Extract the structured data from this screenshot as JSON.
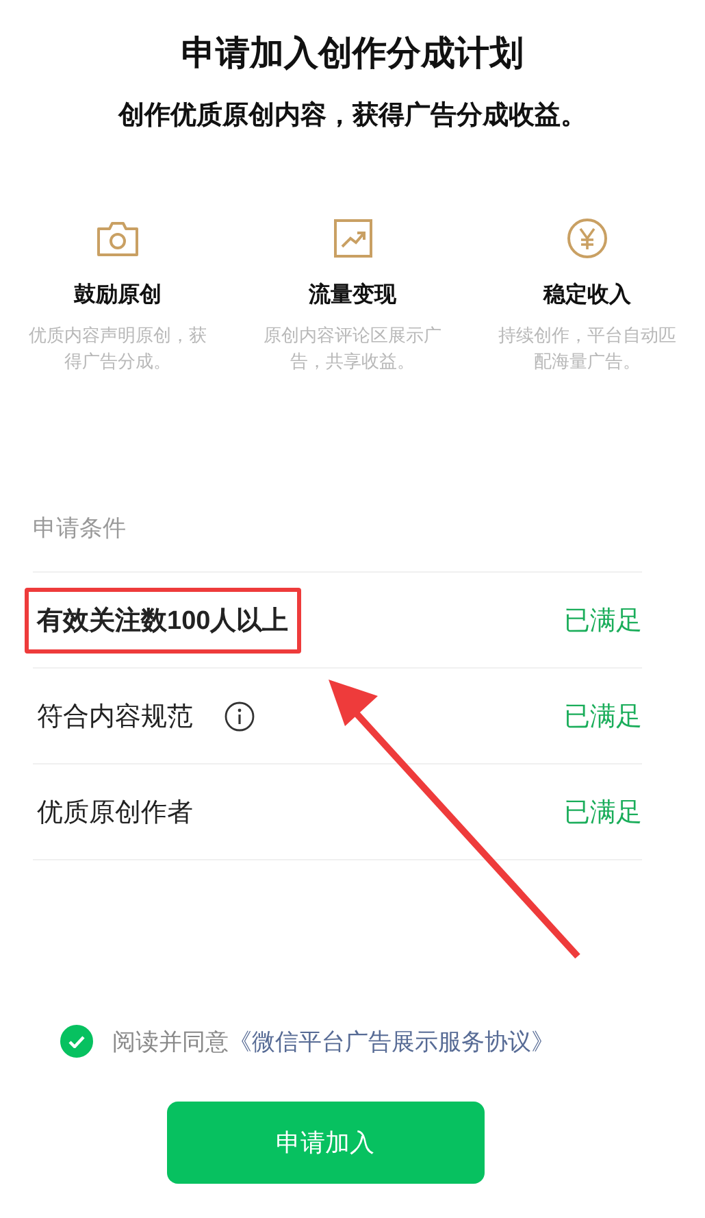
{
  "title": "申请加入创作分成计划",
  "subtitle": "创作优质原创内容，获得广告分成收益。",
  "features": [
    {
      "kind": "camera",
      "title": "鼓励原创",
      "description": "优质内容声明原创，获得广告分成。"
    },
    {
      "kind": "trend",
      "title": "流量变现",
      "description": "原创内容评论区展示广告，共享收益。"
    },
    {
      "kind": "yuan",
      "title": "稳定收入",
      "description": "持续创作，平台自动匹配海量广告。"
    }
  ],
  "conditions_heading": "申请条件",
  "conditions": [
    {
      "label": "有效关注数100人以上",
      "info": false,
      "status": "已满足",
      "highlighted": true
    },
    {
      "label": "符合内容规范",
      "info": true,
      "status": "已满足",
      "highlighted": false
    },
    {
      "label": "优质原创作者",
      "info": false,
      "status": "已满足",
      "highlighted": false
    }
  ],
  "agreement": {
    "checked": true,
    "text": "阅读并同意",
    "link": "《微信平台广告展示服务协议》"
  },
  "apply_button": "申请加入"
}
